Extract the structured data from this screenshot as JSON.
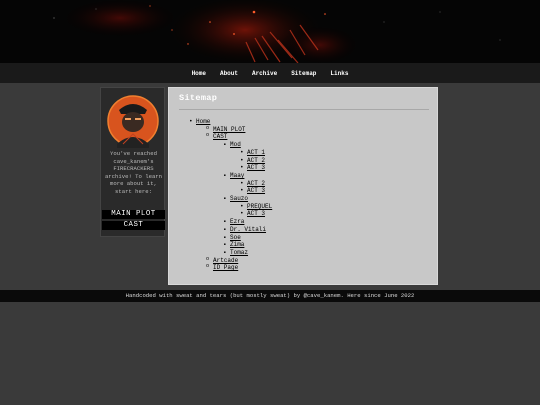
{
  "nav": {
    "items": [
      "Home",
      "About",
      "Archive",
      "Sitemap",
      "Links"
    ]
  },
  "sidebar": {
    "text": "You've reached cave_kanem's FIRECRACKERS archive! To learn more about it, start here:",
    "buttons": [
      "MAIN PLOT",
      "CAST"
    ]
  },
  "main": {
    "title": "Sitemap",
    "tree": [
      {
        "label": "Home",
        "level": 0
      },
      {
        "label": "MAIN PLOT",
        "level": 1
      },
      {
        "label": "CAST",
        "level": 1
      },
      {
        "label": "Mod",
        "level": 2
      },
      {
        "label": "ACT 1",
        "level": 3
      },
      {
        "label": "ACT 2",
        "level": 3
      },
      {
        "label": "ACT 3",
        "level": 3
      },
      {
        "label": "Maay",
        "level": 2
      },
      {
        "label": "ACT 2",
        "level": 3
      },
      {
        "label": "ACT 3",
        "level": 3
      },
      {
        "label": "Sauzo",
        "level": 2
      },
      {
        "label": "PREQUEL",
        "level": 3
      },
      {
        "label": "ACT 3",
        "level": 3
      },
      {
        "label": "Ezra",
        "level": 2
      },
      {
        "label": "Dr. Vitali",
        "level": 2
      },
      {
        "label": "Soe",
        "level": 2
      },
      {
        "label": "Zima",
        "level": 2
      },
      {
        "label": "Tomaz",
        "level": 2
      },
      {
        "label": "Artcade",
        "level": 1
      },
      {
        "label": "ID Page",
        "level": 1
      }
    ]
  },
  "footer": {
    "text": "Handcoded with sweat and tears (but mostly sweat) by @cave_kanem. Here since June 2022"
  },
  "colors": {
    "page_bg": "#3a3a3a",
    "content_bg": "#c8c8c8",
    "banner_accent": "#e0401a",
    "bar_bg": "#1a1a1a"
  }
}
